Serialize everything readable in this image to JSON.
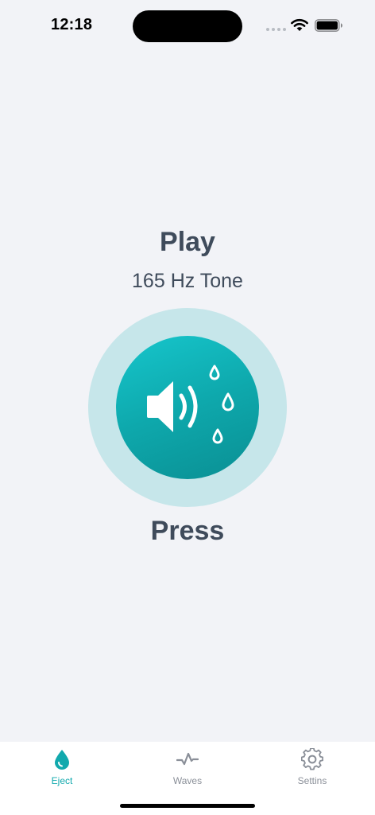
{
  "status_bar": {
    "time": "12:18"
  },
  "main": {
    "title": "Play",
    "tone": "165 Hz Tone",
    "action_label": "Press",
    "play_icon": "speaker-water-drops-icon"
  },
  "tab_bar": {
    "tabs": [
      {
        "label": "Eject",
        "icon": "water-drop-icon",
        "active": true
      },
      {
        "label": "Waves",
        "icon": "waveform-icon",
        "active": false
      },
      {
        "label": "Settins",
        "icon": "gear-icon",
        "active": false
      }
    ]
  },
  "colors": {
    "accent": "#11a9ad",
    "background": "#f2f3f7",
    "text": "#3f4b5b",
    "ring": "#c6e6ea",
    "inactive": "#8a8f98"
  }
}
